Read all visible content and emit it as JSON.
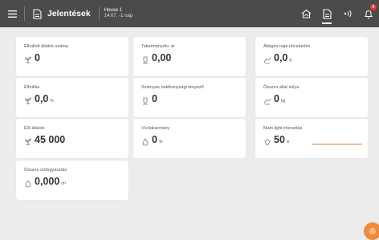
{
  "header": {
    "title": "Jelentések",
    "house_name": "House 1",
    "house_sub": "14:07, -1 nap",
    "notification_count": "5"
  },
  "cards": [
    {
      "label": "Elhullott állatok száma",
      "value": "0",
      "unit": "",
      "icon": "sprout-icon"
    },
    {
      "label": "Takarmányátv. ar",
      "value": "0,00",
      "unit": "",
      "icon": "feed-bin-icon"
    },
    {
      "label": "Átlagos napi növekedés",
      "value": "0,0",
      "unit": "g",
      "icon": "scale-leaf-icon"
    },
    {
      "label": "Elhullás",
      "value": "0,0",
      "unit": "%",
      "icon": "sprout-icon"
    },
    {
      "label": "Szárnyas hatékonysági tényező",
      "value": "0",
      "unit": "",
      "icon": "feed-bin-icon"
    },
    {
      "label": "Összes állat súlya",
      "value": "0",
      "unit": "kg",
      "icon": "scale-leaf-icon"
    },
    {
      "label": "Élő állatok",
      "value": "45 000",
      "unit": "",
      "icon": "sprout-icon"
    },
    {
      "label": "Víz/takarmány",
      "value": "0",
      "unit": "%",
      "icon": "water-drop-icon"
    },
    {
      "label": "Main light intenzitás",
      "value": "50",
      "unit": "lx",
      "icon": "light-bulb-icon"
    },
    {
      "label": "Összes vízfogyasztás",
      "value": "0,000",
      "unit": "m³",
      "icon": "water-drop-icon"
    }
  ],
  "colors": {
    "topbar": "#4b4b4b",
    "accent": "#f08a3b",
    "badge": "#e53935",
    "background": "#ececec"
  }
}
